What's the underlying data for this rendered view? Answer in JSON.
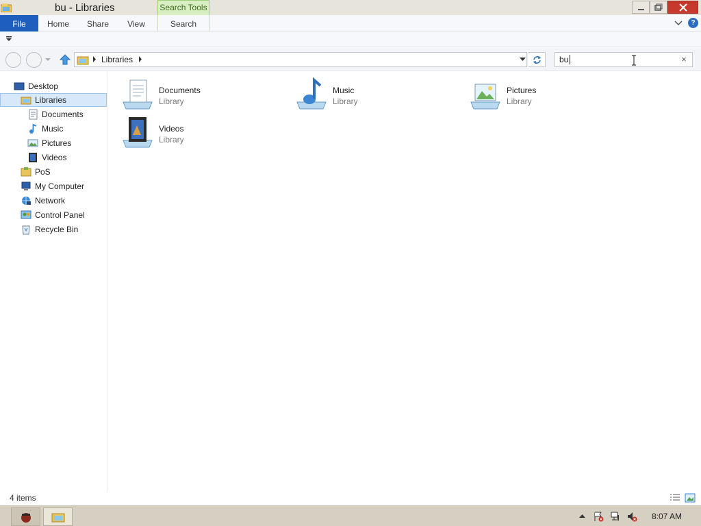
{
  "window": {
    "title": "bu - Libraries",
    "contextual_tab_group": "Search Tools"
  },
  "ribbon": {
    "tabs": [
      {
        "label": "File"
      },
      {
        "label": "Home"
      },
      {
        "label": "Share"
      },
      {
        "label": "View"
      },
      {
        "label": "Search"
      }
    ]
  },
  "navbar": {
    "breadcrumb": [
      "Libraries"
    ],
    "search_value": "bu"
  },
  "nav_pane": {
    "items": [
      {
        "label": "Desktop",
        "icon": "desktop-icon"
      },
      {
        "label": "Libraries",
        "icon": "libraries-icon",
        "selected": true
      },
      {
        "label": "Documents",
        "icon": "documents-icon"
      },
      {
        "label": "Music",
        "icon": "music-icon"
      },
      {
        "label": "Pictures",
        "icon": "pictures-icon"
      },
      {
        "label": "Videos",
        "icon": "videos-icon"
      },
      {
        "label": "PoS",
        "icon": "folder-icon"
      },
      {
        "label": "My Computer",
        "icon": "computer-icon"
      },
      {
        "label": "Network",
        "icon": "network-icon"
      },
      {
        "label": "Control Panel",
        "icon": "control-panel-icon"
      },
      {
        "label": "Recycle Bin",
        "icon": "recycle-bin-icon"
      }
    ]
  },
  "content": {
    "items": [
      {
        "name": "Documents",
        "kind": "Library",
        "icon": "documents-library-icon"
      },
      {
        "name": "Music",
        "kind": "Library",
        "icon": "music-library-icon"
      },
      {
        "name": "Pictures",
        "kind": "Library",
        "icon": "pictures-library-icon"
      },
      {
        "name": "Videos",
        "kind": "Library",
        "icon": "videos-library-icon"
      }
    ]
  },
  "status": {
    "item_count": "4 items"
  },
  "taskbar": {
    "clock": "8:07 AM"
  },
  "colors": {
    "accent": "#1e5ebd",
    "selection": "#d7e8fb",
    "contextual_tab": "#d9eec2",
    "close_button": "#c7392c"
  }
}
